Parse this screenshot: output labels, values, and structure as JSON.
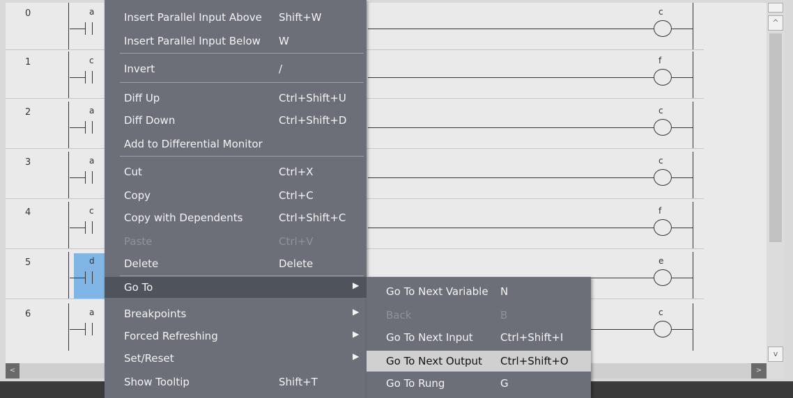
{
  "rungs": [
    {
      "number": "0",
      "contact": "a",
      "coil": "c",
      "selected": false
    },
    {
      "number": "1",
      "contact": "c",
      "coil": "f",
      "selected": false
    },
    {
      "number": "2",
      "contact": "a",
      "coil": "c",
      "selected": false
    },
    {
      "number": "3",
      "contact": "a",
      "coil": "c",
      "selected": false
    },
    {
      "number": "4",
      "contact": "c",
      "coil": "f",
      "selected": false
    },
    {
      "number": "5",
      "contact": "d",
      "coil": "e",
      "selected": true
    },
    {
      "number": "6",
      "contact": "a",
      "coil": "c",
      "selected": false
    }
  ],
  "context_menu": {
    "items": [
      {
        "label": "Insert Parallel Input Above",
        "shortcut": "Shift+W"
      },
      {
        "label": "Insert Parallel Input Below",
        "shortcut": "W"
      },
      {
        "label": "Invert",
        "shortcut": "/"
      },
      {
        "label": "Diff Up",
        "shortcut": "Ctrl+Shift+U"
      },
      {
        "label": "Diff Down",
        "shortcut": "Ctrl+Shift+D"
      },
      {
        "label": "Add to Differential Monitor",
        "shortcut": ""
      },
      {
        "label": "Cut",
        "shortcut": "Ctrl+X"
      },
      {
        "label": "Copy",
        "shortcut": "Ctrl+C"
      },
      {
        "label": "Copy with Dependents",
        "shortcut": "Ctrl+Shift+C"
      },
      {
        "label": "Paste",
        "shortcut": "Ctrl+V",
        "disabled": true
      },
      {
        "label": "Delete",
        "shortcut": "Delete"
      },
      {
        "label": "Go To",
        "shortcut": "",
        "submenu": true,
        "highlighted": true
      },
      {
        "label": "Breakpoints",
        "shortcut": "",
        "submenu": true
      },
      {
        "label": "Forced Refreshing",
        "shortcut": "",
        "submenu": true
      },
      {
        "label": "Set/Reset",
        "shortcut": "",
        "submenu": true
      },
      {
        "label": "Show Tooltip",
        "shortcut": "Shift+T"
      }
    ]
  },
  "goto_submenu": {
    "items": [
      {
        "label": "Go To Next Variable",
        "shortcut": "N"
      },
      {
        "label": "Back",
        "shortcut": "B",
        "disabled": true
      },
      {
        "label": "Go To Next Input",
        "shortcut": "Ctrl+Shift+I"
      },
      {
        "label": "Go To Next Output",
        "shortcut": "Ctrl+Shift+O",
        "highlighted": true
      },
      {
        "label": "Go To Rung",
        "shortcut": "G"
      }
    ]
  },
  "icons": {
    "submenu_arrow": "▶",
    "scroll_up": "^",
    "scroll_down": "v",
    "scroll_left": "<",
    "scroll_right": ">"
  }
}
